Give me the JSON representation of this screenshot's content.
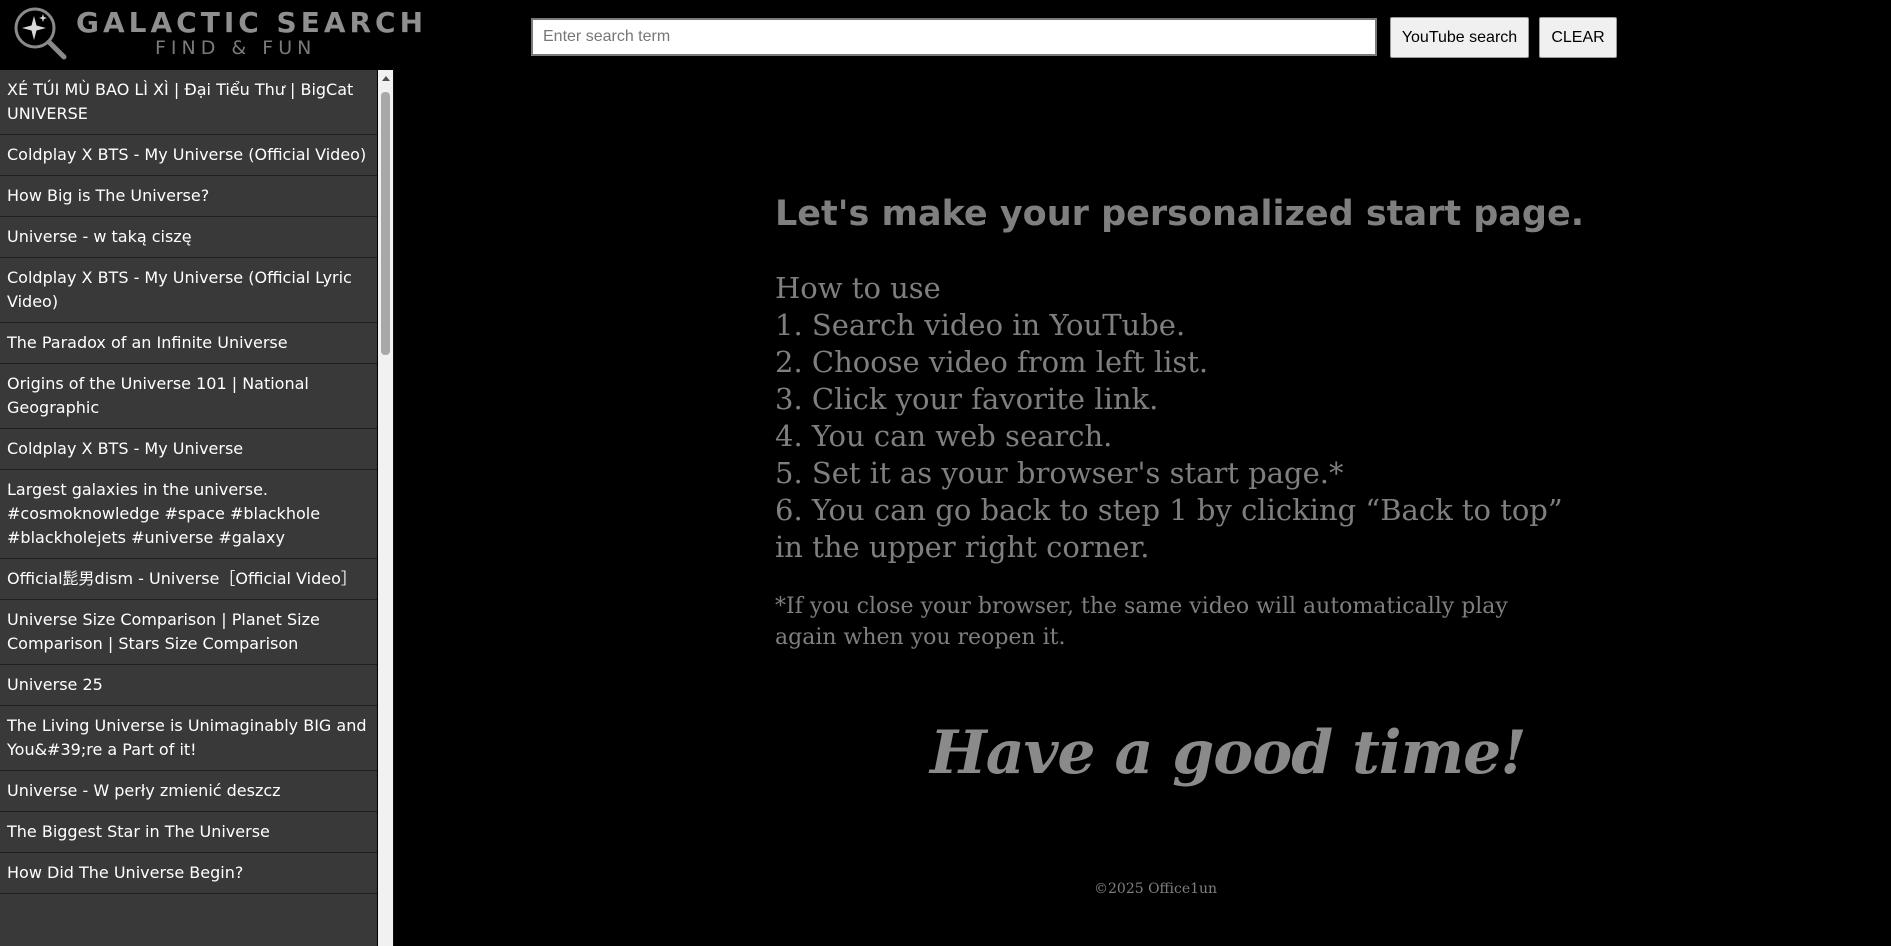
{
  "logo": {
    "title": "GALACTIC SEARCH",
    "subtitle": "FIND & FUN",
    "icon": "magnifier-sparkle-icon"
  },
  "search": {
    "placeholder": "Enter search term",
    "value": "",
    "youtube_button": "YouTube search",
    "clear_button": "CLEAR"
  },
  "sidebar": {
    "items": [
      {
        "label": "XÉ TÚI MÙ BAO LÌ XÌ | Đại Tiểu Thư | BigCat UNIVERSE"
      },
      {
        "label": "Coldplay X BTS - My Universe (Official Video)"
      },
      {
        "label": "How Big is The Universe?"
      },
      {
        "label": "Universe - w taką ciszę"
      },
      {
        "label": "Coldplay X BTS - My Universe (Official Lyric Video)"
      },
      {
        "label": "The Paradox of an Infinite Universe"
      },
      {
        "label": "Origins of the Universe 101 | National Geographic"
      },
      {
        "label": "Coldplay X BTS - My Universe"
      },
      {
        "label": "Largest galaxies in the universe. #cosmoknowledge #space #blackhole #blackholejets #universe #galaxy"
      },
      {
        "label": "Official髭男dism - Universe［Official Video］"
      },
      {
        "label": "Universe Size Comparison | Planet Size Comparison | Stars Size Comparison"
      },
      {
        "label": "Universe 25"
      },
      {
        "label": "The Living Universe is Unimaginably BIG and You&#39;re a Part of it!"
      },
      {
        "label": "Universe - W perły zmienić deszcz"
      },
      {
        "label": "The Biggest Star in The Universe"
      },
      {
        "label": "How Did The Universe Begin?"
      }
    ]
  },
  "main": {
    "headline": "Let's make your personalized start page.",
    "steps": [
      "How to use",
      "1. Search video in YouTube.",
      "2. Choose video from left list.",
      "3. Click your favorite link.",
      "4. You can web search.",
      "5. Set it as your browser's start page.*",
      "6. You can go back to step 1 by clicking “Back to top”",
      "in the upper right corner."
    ],
    "note": "*If you close your browser, the same video will automatically play again when you reopen it.",
    "goodtime": "Have a good time!",
    "footer": "©2025 Office1un"
  }
}
